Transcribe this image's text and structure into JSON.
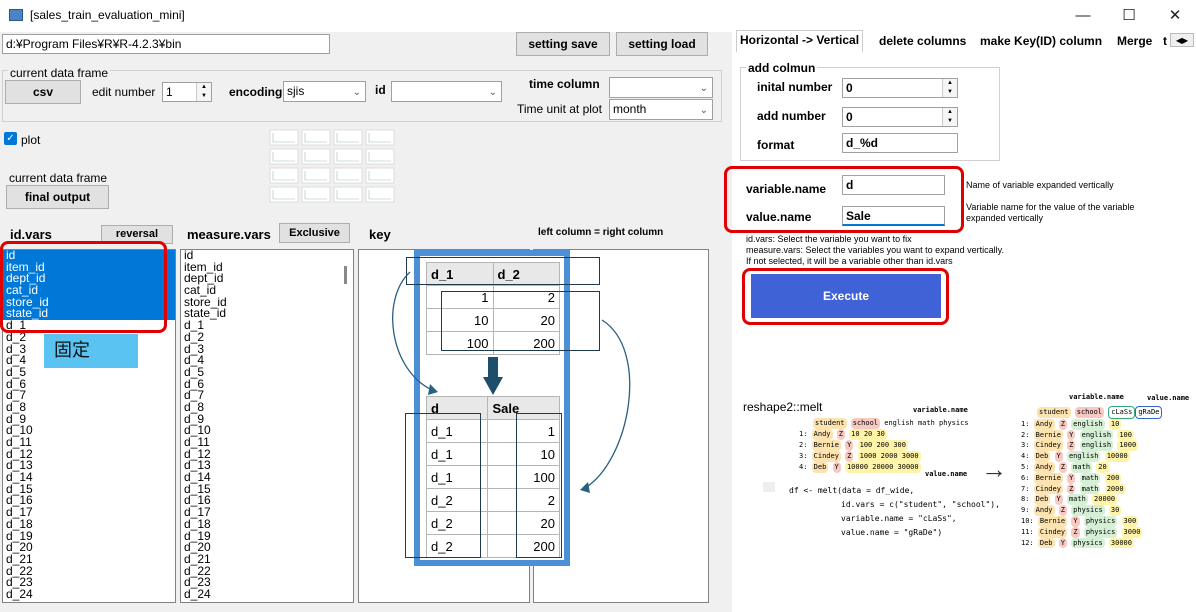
{
  "window": {
    "title": "[sales_train_evaluation_mini]",
    "minimize": "—",
    "maximize": "☐",
    "close": "✕"
  },
  "path": "d:¥Program Files¥R¥R-4.2.3¥bin",
  "buttons": {
    "setting_save": "setting save",
    "setting_load": "setting load",
    "csv": "csv",
    "final_output": "final output",
    "reversal": "reversal",
    "exclusive": "Exclusive",
    "execute": "Execute"
  },
  "frame": {
    "current_data_frame": "current data frame",
    "edit_number_label": "edit number",
    "edit_number": "1",
    "encoding_label": "encoding",
    "encoding": "sjis",
    "id_label": "id",
    "id_value": "",
    "time_column_label": "time column",
    "time_column": "",
    "time_unit_label": "Time unit at plot",
    "time_unit": "month",
    "plot_label": "plot",
    "current_data_frame2": "current data frame"
  },
  "lists": {
    "idvars_label": "id.vars",
    "measure_label": "measure.vars",
    "key_label": "key",
    "left_right": "left column = right  column",
    "idvars": [
      "id",
      "item_id",
      "dept_id",
      "cat_id",
      "store_id",
      "state_id",
      "d_1",
      "d_2",
      "d_3",
      "d_4",
      "d_5",
      "d_6",
      "d_7",
      "d_8",
      "d_9",
      "d_10",
      "d_11",
      "d_12",
      "d_13",
      "d_14",
      "d_15",
      "d_16",
      "d_17",
      "d_18",
      "d_19",
      "d_20",
      "d_21",
      "d_22",
      "d_23",
      "d_24"
    ],
    "measure": [
      "id",
      "item_id",
      "dept_id",
      "cat_id",
      "store_id",
      "state_id",
      "d_1",
      "d_2",
      "d_3",
      "d_4",
      "d_5",
      "d_6",
      "d_7",
      "d_8",
      "d_9",
      "d_10",
      "d_11",
      "d_12",
      "d_13",
      "d_14",
      "d_15",
      "d_16",
      "d_17",
      "d_18",
      "d_19",
      "d_20",
      "d_21",
      "d_22",
      "d_23",
      "d_24"
    ]
  },
  "fixed_label": "固定",
  "tabs": [
    "Horizontal -> Vertical",
    "delete columns",
    "make Key(ID) column",
    "Merge",
    "t"
  ],
  "add_column": {
    "group": "add colmun",
    "initial_label": "inital number",
    "initial": "0",
    "add_label": "add number",
    "add": "0",
    "format_label": "format",
    "format": "d_%d"
  },
  "variable": {
    "name_label": "variable.name",
    "name": "d",
    "name_help": "Name of variable expanded vertically",
    "value_label": "value.name",
    "value": "Sale",
    "value_help": "Variable name for the value of the variable expanded vertically"
  },
  "help": [
    "id.vars: Select the variable you want to fix",
    "measure.vars: Select the variables you want to expand vertically.",
    "If not selected, it will be a variable other than id.vars"
  ],
  "wide_table": {
    "headers": [
      "d_1",
      "d_2"
    ],
    "rows": [
      [
        "1",
        "2"
      ],
      [
        "10",
        "20"
      ],
      [
        "100",
        "200"
      ]
    ]
  },
  "long_table": {
    "headers": [
      "d",
      "Sale"
    ],
    "rows": [
      [
        "d_1",
        "1"
      ],
      [
        "d_1",
        "10"
      ],
      [
        "d_1",
        "100"
      ],
      [
        "d_2",
        "2"
      ],
      [
        "d_2",
        "20"
      ],
      [
        "d_2",
        "200"
      ]
    ]
  },
  "melt": {
    "title": "reshape2::melt",
    "var_name": "variable.name",
    "value_name": "value.name",
    "left_head": [
      "student",
      "school",
      "english",
      "math",
      "physics"
    ],
    "left_rows": [
      [
        "1:",
        "Andy",
        "Z",
        "10",
        "20",
        "30"
      ],
      [
        "2:",
        "Bernie",
        "Y",
        "100",
        "200",
        "300"
      ],
      [
        "3:",
        "Cindey",
        "Z",
        "1000",
        "2000",
        "3000"
      ],
      [
        "4:",
        "Deb",
        "Y",
        "10000",
        "20000",
        "30000"
      ]
    ],
    "right_head": [
      "student",
      "school",
      "cLaSs",
      "gRaDe"
    ],
    "right_rows": [
      [
        "1:",
        "Andy",
        "Z",
        "english",
        "10"
      ],
      [
        "2:",
        "Bernie",
        "Y",
        "english",
        "100"
      ],
      [
        "3:",
        "Cindey",
        "Z",
        "english",
        "1000"
      ],
      [
        "4:",
        "Deb",
        "Y",
        "english",
        "10000"
      ],
      [
        "5:",
        "Andy",
        "Z",
        "math",
        "20"
      ],
      [
        "6:",
        "Bernie",
        "Y",
        "math",
        "200"
      ],
      [
        "7:",
        "Cindey",
        "Z",
        "math",
        "2000"
      ],
      [
        "8:",
        "Deb",
        "Y",
        "math",
        "20000"
      ],
      [
        "9:",
        "Andy",
        "Z",
        "physics",
        "30"
      ],
      [
        "10:",
        "Bernie",
        "Y",
        "physics",
        "300"
      ],
      [
        "11:",
        "Cindey",
        "Z",
        "physics",
        "3000"
      ],
      [
        "12:",
        "Deb",
        "Y",
        "physics",
        "30000"
      ]
    ],
    "code": [
      "df <- melt(data = df_wide,",
      "id.vars = c(\"student\", \"school\"),",
      "variable.name = \"cLaSs\",",
      "value.name = \"gRaDe\")"
    ]
  }
}
